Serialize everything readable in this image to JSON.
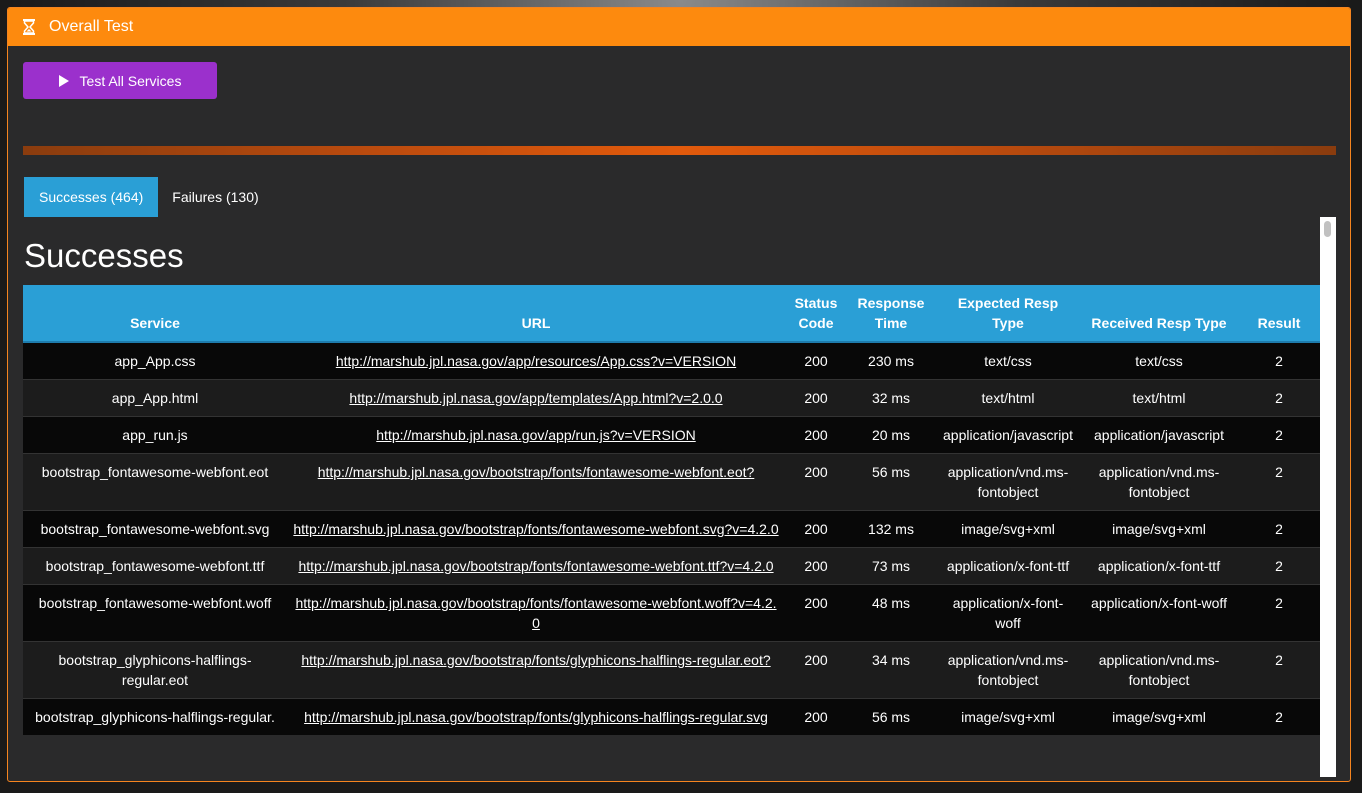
{
  "panel": {
    "title": "Overall Test",
    "icon": "hourglass-icon",
    "accent_color": "#fd8a0e"
  },
  "actions": {
    "test_all_label": "Test All Services",
    "button_color": "#9b30cc"
  },
  "tabs": [
    {
      "label": "Successes (464)",
      "active": true
    },
    {
      "label": "Failures (130)",
      "active": false
    }
  ],
  "section_title": "Successes",
  "table": {
    "headers": [
      "Service",
      "URL",
      "Status Code",
      "Response Time",
      "Expected Resp Type",
      "Received Resp Type",
      "Result"
    ],
    "rows": [
      {
        "service": "app_App.css",
        "url": "http://marshub.jpl.nasa.gov/app/resources/App.css?v=VERSION",
        "status": "200",
        "time": "230 ms",
        "expected": "text/css",
        "received": "text/css",
        "result": "2"
      },
      {
        "service": "app_App.html",
        "url": "http://marshub.jpl.nasa.gov/app/templates/App.html?v=2.0.0",
        "status": "200",
        "time": "32 ms",
        "expected": "text/html",
        "received": "text/html",
        "result": "2"
      },
      {
        "service": "app_run.js",
        "url": "http://marshub.jpl.nasa.gov/app/run.js?v=VERSION",
        "status": "200",
        "time": "20 ms",
        "expected": "application/javascript",
        "received": "application/javascript",
        "result": "2"
      },
      {
        "service": "bootstrap_fontawesome-webfont.eot",
        "url": "http://marshub.jpl.nasa.gov/bootstrap/fonts/fontawesome-webfont.eot?",
        "status": "200",
        "time": "56 ms",
        "expected": "application/vnd.ms-fontobject",
        "received": "application/vnd.ms-fontobject",
        "result": "2"
      },
      {
        "service": "bootstrap_fontawesome-webfont.svg",
        "url": "http://marshub.jpl.nasa.gov/bootstrap/fonts/fontawesome-webfont.svg?v=4.2.0",
        "status": "200",
        "time": "132 ms",
        "expected": "image/svg+xml",
        "received": "image/svg+xml",
        "result": "2"
      },
      {
        "service": "bootstrap_fontawesome-webfont.ttf",
        "url": "http://marshub.jpl.nasa.gov/bootstrap/fonts/fontawesome-webfont.ttf?v=4.2.0",
        "status": "200",
        "time": "73 ms",
        "expected": "application/x-font-ttf",
        "received": "application/x-font-ttf",
        "result": "2"
      },
      {
        "service": "bootstrap_fontawesome-webfont.woff",
        "url": "http://marshub.jpl.nasa.gov/bootstrap/fonts/fontawesome-webfont.woff?v=4.2.0",
        "status": "200",
        "time": "48 ms",
        "expected": "application/x-font-woff",
        "received": "application/x-font-woff",
        "result": "2"
      },
      {
        "service": "bootstrap_glyphicons-halflings-regular.eot",
        "url": "http://marshub.jpl.nasa.gov/bootstrap/fonts/glyphicons-halflings-regular.eot?",
        "status": "200",
        "time": "34 ms",
        "expected": "application/vnd.ms-fontobject",
        "received": "application/vnd.ms-fontobject",
        "result": "2"
      },
      {
        "service": "bootstrap_glyphicons-halflings-regular.",
        "url": "http://marshub.jpl.nasa.gov/bootstrap/fonts/glyphicons-halflings-regular.svg",
        "status": "200",
        "time": "56 ms",
        "expected": "image/svg+xml",
        "received": "image/svg+xml",
        "result": "2"
      }
    ]
  }
}
